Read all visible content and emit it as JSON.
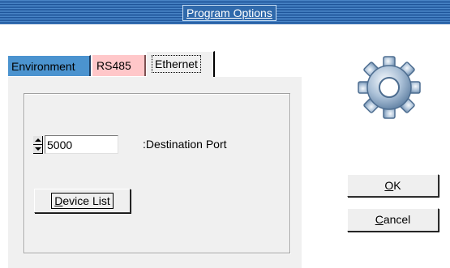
{
  "window": {
    "title": "Program Options"
  },
  "tabs": [
    {
      "label": "Environment",
      "color": "#4b93cf"
    },
    {
      "label": "RS485",
      "color": "#ffc7c9"
    },
    {
      "label": "Ethernet",
      "selected": true
    }
  ],
  "ethernet": {
    "destination_port": {
      "value": "5000",
      "label": ":Destination Port"
    },
    "device_list_button": {
      "mnemonic": "D",
      "rest": "evice List"
    }
  },
  "buttons": {
    "ok": {
      "mnemonic": "O",
      "rest": "K"
    },
    "cancel": {
      "mnemonic": "C",
      "rest": "ancel"
    }
  },
  "icons": {
    "settings": "gear-icon"
  }
}
